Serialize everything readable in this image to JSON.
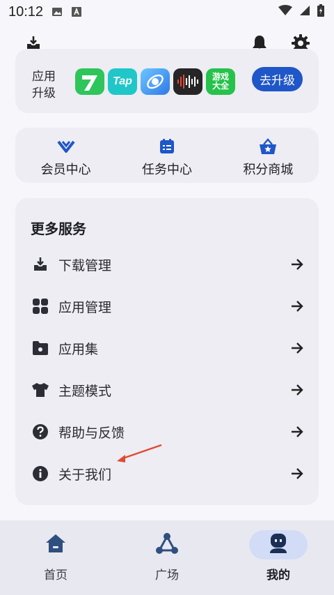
{
  "status_bar": {
    "time": "10:12",
    "icons": [
      "image-icon",
      "a-icon",
      "wifi-icon",
      "signal-icon",
      "battery-icon"
    ]
  },
  "top_bar": {
    "icons": [
      "download-icon",
      "bell-icon",
      "gear-icon"
    ]
  },
  "upgrade_card": {
    "label_line1": "应用",
    "label_line2": "升级",
    "apps": [
      {
        "name": "seven-app-icon",
        "text": "7",
        "color": "#2ec55a"
      },
      {
        "name": "taptap-app-icon",
        "text": "Tap",
        "color": "#1fc7c9"
      },
      {
        "name": "browser-app-icon",
        "text": "",
        "color": "#3a8ff0"
      },
      {
        "name": "voice-app-icon",
        "text": "",
        "color": "#2a2a2a"
      },
      {
        "name": "game-app-icon",
        "text": "游戏大全",
        "color": "#26c24b"
      }
    ],
    "button_label": "去升级"
  },
  "shortcuts": [
    {
      "label": "会员中心",
      "icon": "vip-icon"
    },
    {
      "label": "任务中心",
      "icon": "task-icon"
    },
    {
      "label": "积分商城",
      "icon": "shop-basket-icon"
    }
  ],
  "services": {
    "title": "更多服务",
    "items": [
      {
        "label": "下载管理",
        "icon": "download-icon"
      },
      {
        "label": "应用管理",
        "icon": "grid-icon"
      },
      {
        "label": "应用集",
        "icon": "folder-icon"
      },
      {
        "label": "主题模式",
        "icon": "tshirt-icon"
      },
      {
        "label": "帮助与反馈",
        "icon": "help-icon"
      },
      {
        "label": "关于我们",
        "icon": "info-icon"
      }
    ]
  },
  "bottom_nav": {
    "items": [
      {
        "label": "首页",
        "icon": "home-icon",
        "active": false
      },
      {
        "label": "广场",
        "icon": "plaza-icon",
        "active": false
      },
      {
        "label": "我的",
        "icon": "profile-icon",
        "active": true
      }
    ]
  },
  "colors": {
    "accent": "#1f56c8",
    "icon_dark": "#2d2d36",
    "annotation": "#e04a2f"
  }
}
